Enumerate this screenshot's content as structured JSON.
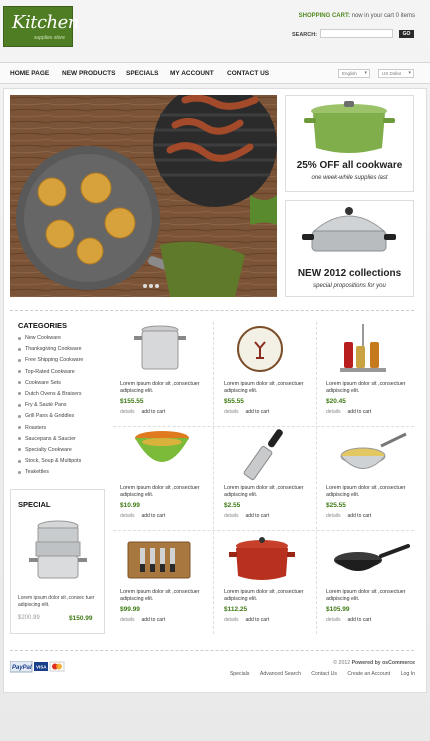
{
  "logo": {
    "title": "Kitchen",
    "subtitle": "supplies store"
  },
  "header": {
    "cart_label": "SHOPPING CART:",
    "cart_text": " now in your cart 0 items",
    "search_label": "SEARCH:",
    "search_button": "GO"
  },
  "nav": {
    "items": [
      "HOME PAGE",
      "NEW PRODUCTS",
      "SPECIALS",
      "MY ACCOUNT",
      "CONTACT US"
    ],
    "language": "English",
    "currency": "US Dollar"
  },
  "promos": [
    {
      "title": "25% OFF all cookware",
      "subtitle": "one week-while supplies last"
    },
    {
      "title": "NEW 2012 collections",
      "subtitle": "special propositions for you"
    }
  ],
  "categories": {
    "title": "CATEGORIES",
    "items": [
      "New Cookware",
      "Thanksgiving Cookware",
      "Free Shipping Cookware",
      "Top-Rated Cookware",
      "Cookware Sets",
      "Dutch Ovens & Braisers",
      "Fry & Sauté Pans",
      "Grill Pans & Griddles",
      "Roasters",
      "Saucepans & Saucier",
      "Specialty Cookware",
      "Stock, Soup & Multipots",
      "Teakettles"
    ]
  },
  "special": {
    "title": "SPECIAL",
    "description": "Lorem ipsum dolor sit ,consec tuer adipiscing elit.",
    "old_price": "$200.99",
    "new_price": "$150.99"
  },
  "products": [
    {
      "desc": "Lorem ipsum dolor sit ,consectuer adipiscing elit.",
      "price": "$155.55",
      "icon": "stockpot"
    },
    {
      "desc": "Lorem ipsum dolor sit ,consectuer adipiscing elit.",
      "price": "$55.55",
      "icon": "plate"
    },
    {
      "desc": "Lorem ipsum dolor sit ,consectuer adipiscing elit.",
      "price": "$20.45",
      "icon": "cruet"
    },
    {
      "desc": "Lorem ipsum dolor sit ,consectuer adipiscing elit.",
      "price": "$10.99",
      "icon": "bowls"
    },
    {
      "desc": "Lorem ipsum dolor sit ,consectuer adipiscing elit.",
      "price": "$2.55",
      "icon": "grater"
    },
    {
      "desc": "Lorem ipsum dolor sit ,consectuer adipiscing elit.",
      "price": "$25.55",
      "icon": "sauce-pan"
    },
    {
      "desc": "Lorem ipsum dolor sit ,consectuer adipiscing elit.",
      "price": "$99.99",
      "icon": "cheese-knives"
    },
    {
      "desc": "Lorem ipsum dolor sit ,consectuer adipiscing elit.",
      "price": "$112.25",
      "icon": "dutch-oven"
    },
    {
      "desc": "Lorem ipsum dolor sit ,consectuer adipiscing elit.",
      "price": "$105.99",
      "icon": "wok"
    }
  ],
  "product_links": {
    "details": "details",
    "add": "add to cart"
  },
  "footer": {
    "copyright": "© 2012",
    "powered": "Powered by osCommerce",
    "links": [
      "Specials",
      "Advanced Search",
      "Contact Us",
      "Create an Account",
      "Log In"
    ]
  },
  "colors": {
    "brand": "#4f7d24",
    "price": "#3d7a13",
    "promo_pot": "#7fae4a"
  }
}
